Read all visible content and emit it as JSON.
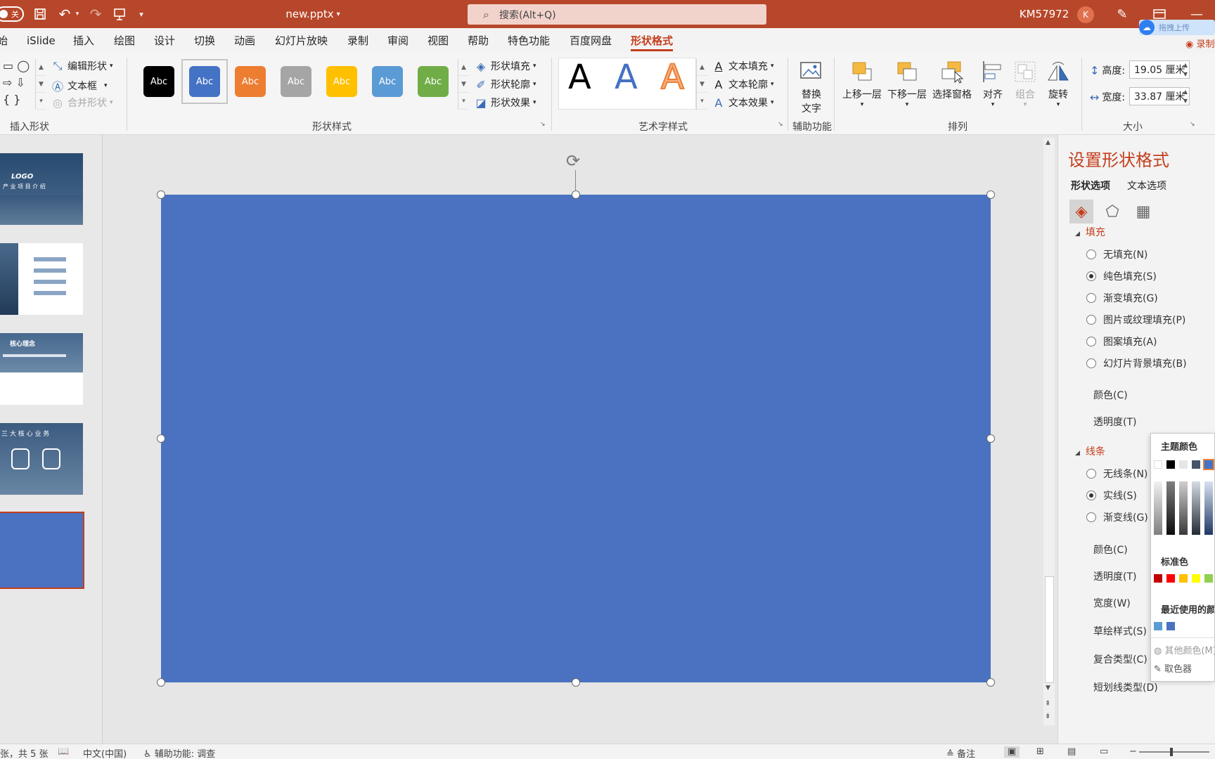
{
  "titlebar": {
    "autosave": "关",
    "doc_title": "new.pptx",
    "search_placeholder": "搜索(Alt+Q)",
    "user_id": "KM57972",
    "avatar_initial": "K"
  },
  "tabs": [
    "始",
    "iSlide",
    "插入",
    "绘图",
    "设计",
    "切换",
    "动画",
    "幻灯片放映",
    "录制",
    "审阅",
    "视图",
    "帮助",
    "特色功能",
    "百度网盘",
    "形状格式"
  ],
  "active_tab": "形状格式",
  "upload_chip": "拖拽上传",
  "record_label": "录制",
  "ribbon": {
    "insert_shapes": {
      "label": "插入形状",
      "edit_shape": "编辑形状",
      "text_box": "文本框",
      "merge_shapes": "合并形状"
    },
    "shape_styles": {
      "label": "形状样式",
      "swatches": [
        {
          "text": "Abc",
          "color": "#000000"
        },
        {
          "text": "Abc",
          "color": "#4472c4"
        },
        {
          "text": "Abc",
          "color": "#ed7d31"
        },
        {
          "text": "Abc",
          "color": "#a5a5a5"
        },
        {
          "text": "Abc",
          "color": "#ffc000"
        },
        {
          "text": "Abc",
          "color": "#5b9bd5"
        },
        {
          "text": "Abc",
          "color": "#70ad47"
        }
      ],
      "fill": "形状填充",
      "outline": "形状轮廓",
      "effects": "形状效果"
    },
    "wordart": {
      "label": "艺术字样式",
      "letter": "A",
      "text_fill": "文本填充",
      "text_outline": "文本轮廓",
      "text_effects": "文本效果"
    },
    "accessibility": {
      "label": "辅助功能",
      "alt_text_1": "替换",
      "alt_text_2": "文字"
    },
    "arrange": {
      "label": "排列",
      "bring_forward": "上移一层",
      "send_backward": "下移一层",
      "selection_pane": "选择窗格",
      "align": "对齐",
      "group": "组合",
      "rotate": "旋转"
    },
    "size": {
      "label": "大小",
      "height_label": "高度:",
      "height_value": "19.05 厘米",
      "width_label": "宽度:",
      "width_value": "33.87 厘米"
    }
  },
  "thumbnails": {
    "slide1_logo": "LOGO",
    "slide1_title": "产 业 项 目 介 绍",
    "slide3_title": "核心理念",
    "slide4_title": "三 大 核 心 业 务"
  },
  "format_pane": {
    "title": "设置形状格式",
    "tab_shape": "形状选项",
    "tab_text": "文本选项",
    "fill_section": "填充",
    "fill_options": [
      "无填充(N)",
      "纯色填充(S)",
      "渐变填充(G)",
      "图片或纹理填充(P)",
      "图案填充(A)",
      "幻灯片背景填充(B)"
    ],
    "fill_selected": 1,
    "fill_color": "颜色(C)",
    "fill_transparency": "透明度(T)",
    "line_section": "线条",
    "line_options": [
      "无线条(N)",
      "实线(S)",
      "渐变线(G)"
    ],
    "line_selected": 1,
    "line_color": "颜色(C)",
    "line_transparency": "透明度(T)",
    "line_width": "宽度(W)",
    "sketch_style": "草绘样式(S)",
    "compound_type": "复合类型(C)",
    "dash_type": "短划线类型(D)"
  },
  "color_popup": {
    "theme_colors": "主题颜色",
    "standard_colors": "标准色",
    "recent_colors": "最近使用的颜色",
    "more_colors": "其他颜色(M)...",
    "eyedropper": "取色器",
    "theme_row": [
      "#ffffff",
      "#000000",
      "#e7e6e6",
      "#44546a",
      "#4472c4"
    ],
    "standard_row": [
      "#c00000",
      "#ff0000",
      "#ffc000",
      "#ffff00",
      "#92d050"
    ],
    "recent_row": [
      "#5b9bd5",
      "#4a72c1"
    ]
  },
  "statusbar": {
    "slide_info": "张，共 5 张",
    "language": "中文(中国)",
    "accessibility": "辅助功能: 调查",
    "notes": "备注"
  },
  "colors": {
    "accent": "#b7472a",
    "shape_fill": "#4a72c1",
    "active_tab": "#c43e1c"
  }
}
